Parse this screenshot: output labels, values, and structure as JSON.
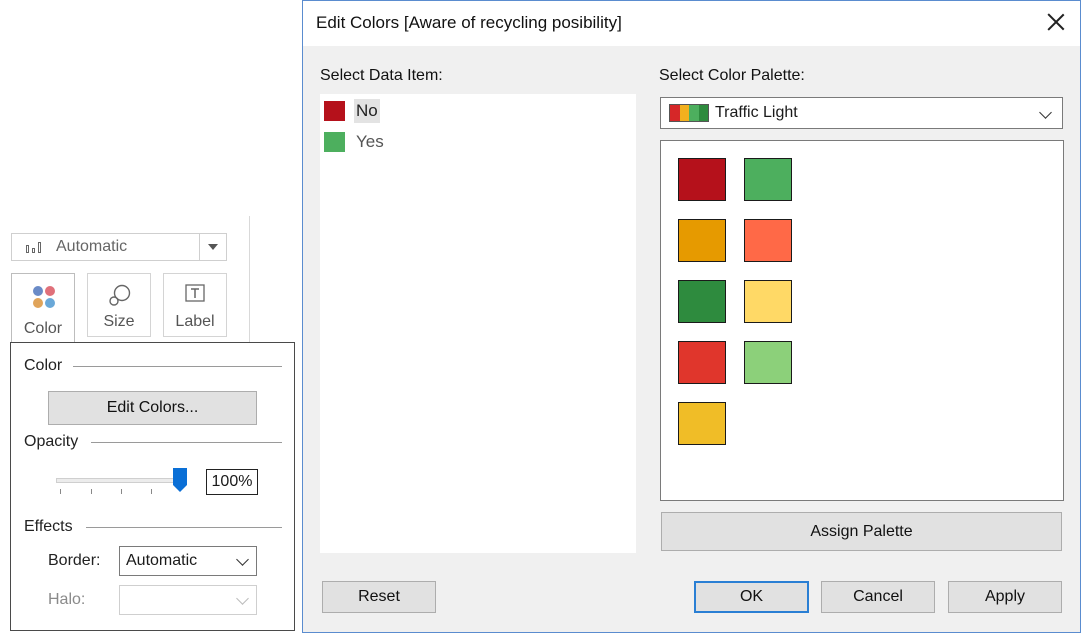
{
  "marks": {
    "mark_type": "Automatic",
    "shelves": [
      {
        "label": "Color",
        "icon": "color-dots-icon"
      },
      {
        "label": "Size",
        "icon": "size-icon"
      },
      {
        "label": "Label",
        "icon": "label-icon"
      }
    ]
  },
  "color_popup": {
    "color_section": "Color",
    "edit_colors_button": "Edit Colors...",
    "opacity_section": "Opacity",
    "opacity_value": "100%",
    "opacity_percent": 100,
    "effects_section": "Effects",
    "border_label": "Border:",
    "border_value": "Automatic",
    "halo_label": "Halo:",
    "halo_value": ""
  },
  "dialog": {
    "title": "Edit Colors [Aware of recycling posibility]",
    "select_data_item_label": "Select Data Item:",
    "data_items": [
      {
        "label": "No",
        "color": "#b5111b",
        "selected": true
      },
      {
        "label": "Yes",
        "color": "#4daf5e",
        "selected": false
      }
    ],
    "select_palette_label": "Select Color Palette:",
    "palette_name": "Traffic Light",
    "palette_icon_colors": [
      "#d62728",
      "#f2b01e",
      "#4daf5e",
      "#2e8b3e"
    ],
    "palette_swatches": [
      "#b5111b",
      "#4daf5e",
      "#e69a00",
      "#ff6947",
      "#2e8b3e",
      "#ffd966",
      "#e0362c",
      "#8cd07a",
      "#f0bd27"
    ],
    "assign_palette_button": "Assign Palette",
    "reset_button": "Reset",
    "ok_button": "OK",
    "cancel_button": "Cancel",
    "apply_button": "Apply"
  }
}
